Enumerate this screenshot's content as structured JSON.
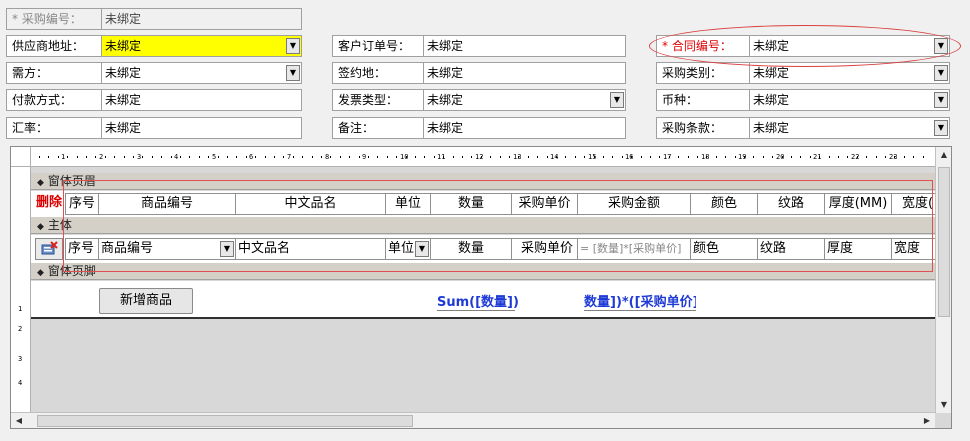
{
  "header_fields": [
    {
      "key": "purchase_no",
      "label": "* 采购编号：",
      "value": "未绑定"
    },
    {
      "key": "supplier",
      "label": "供应商地址：",
      "value": "未绑定"
    },
    {
      "key": "customer_order",
      "label": "客户订单号：",
      "value": "未绑定"
    },
    {
      "key": "contract_no",
      "label": "* 合同编号：",
      "value": "未绑定"
    },
    {
      "key": "demander",
      "label": "需方：",
      "value": "未绑定"
    },
    {
      "key": "sign_place",
      "label": "签约地：",
      "value": "未绑定"
    },
    {
      "key": "purchase_type",
      "label": "采购类别：",
      "value": "未绑定"
    },
    {
      "key": "payment",
      "label": "付款方式：",
      "value": "未绑定"
    },
    {
      "key": "invoice_type",
      "label": "发票类型：",
      "value": "未绑定"
    },
    {
      "key": "currency",
      "label": "币种：",
      "value": "未绑定"
    },
    {
      "key": "rate",
      "label": "汇率：",
      "value": "未绑定"
    },
    {
      "key": "remark",
      "label": "备注：",
      "value": "未绑定"
    },
    {
      "key": "terms",
      "label": "采购条款：",
      "value": "未绑定"
    }
  ],
  "designer": {
    "ruler_h_labels": [
      "1",
      "2",
      "3",
      "4",
      "5",
      "6",
      "7",
      "8",
      "9",
      "10",
      "11",
      "12",
      "13",
      "14",
      "15",
      "16",
      "17",
      "18",
      "19",
      "20",
      "21",
      "22",
      "23"
    ],
    "ruler_v_labels": [
      "1",
      "2",
      "3",
      "4"
    ],
    "sections": {
      "header": "窗体页眉",
      "detail": "主体",
      "footer": "窗体页脚"
    },
    "header_row": {
      "delete": "删除",
      "seq": "序号",
      "code": "商品编号",
      "name": "中文品名",
      "unit": "单位",
      "qty": "数量",
      "price": "采购单价",
      "amount": "采购金额",
      "color": "颜色",
      "grain": "纹路",
      "thickness": "厚度(MM)",
      "width": "宽度("
    },
    "detail_row": {
      "seq": "序号",
      "code": "商品编号",
      "name": "中文品名",
      "unit": "单位",
      "qty": "数量",
      "price": "采购单价",
      "amount": "= [数量]*[采购单价]",
      "color": "颜色",
      "grain": "纹路",
      "thickness": "厚度",
      "width": "宽度"
    },
    "footer": {
      "add_button": "新增商品",
      "sum_expr": "Sum([数量])",
      "amount_expr": "数量])*([采购单价])"
    }
  },
  "colors": {
    "highlight_yellow": "#ffff00",
    "required_red": "#dd0000",
    "expr_blue": "#1f3bd6",
    "annotation_red": "#d94040"
  }
}
